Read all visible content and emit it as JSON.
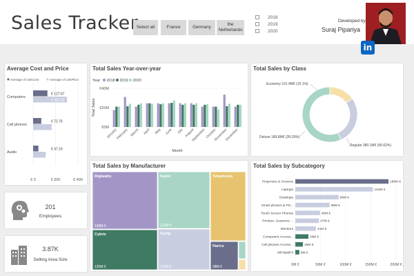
{
  "header": {
    "title": "Sales Tracker",
    "countries": [
      "Select all",
      "France",
      "Germany",
      "the Netherlands"
    ],
    "years": [
      "2018",
      "2019",
      "2020"
    ],
    "developed_by": "Developed by",
    "developer": "Suraj Pipariya",
    "linkedin": "in"
  },
  "colors": {
    "y2018": "#a495c7",
    "y2019": "#3f7a62",
    "y2020": "#a8d5c6",
    "cost": "#6b6e8a",
    "price": "#c9cde0"
  },
  "kpis": {
    "employees_value": "201",
    "employees_label": "Employees",
    "area_value": "3.87K",
    "area_label": "Selling Area Size"
  },
  "chart_data": [
    {
      "type": "bar",
      "title": "Average Cost and Price",
      "orientation": "horizontal",
      "categories": [
        "Computers",
        "Cell phones",
        "Audio"
      ],
      "series": [
        {
          "name": "Average of UnitCost",
          "values": [
            127.67,
            72.76,
            47.19
          ],
          "labels": [
            "€ 127.67",
            "€ 72.76",
            "€ 47.19"
          ]
        },
        {
          "name": "Average of UnitPrice",
          "values": [
            302.13,
            167.08,
            112.03
          ],
          "labels": [
            "€ 302.13",
            "€ 167.08",
            "€ 112.03"
          ]
        }
      ],
      "xticks": [
        "€ 0",
        "€ 200",
        "€ 400"
      ],
      "xlim": [
        0,
        400
      ]
    },
    {
      "type": "bar",
      "title": "Total Sales Year-over-year",
      "legend_title": "Year",
      "categories": [
        "January",
        "February",
        "March",
        "April",
        "May",
        "June",
        "July",
        "August",
        "September",
        "October",
        "November",
        "December"
      ],
      "series": [
        {
          "name": "2018",
          "values": [
            17.5,
            31,
            21,
            24.5,
            24.5,
            24.5,
            24.5,
            24.5,
            21,
            21,
            33.5,
            21
          ]
        },
        {
          "name": "2019",
          "values": [
            21,
            21.5,
            23,
            24.5,
            23.5,
            25,
            23,
            23,
            23,
            21,
            21.5,
            23
          ]
        },
        {
          "name": "2020",
          "values": [
            21,
            24,
            24.5,
            24,
            24.5,
            27.5,
            24.5,
            24.5,
            23.5,
            18,
            24,
            23
          ]
        }
      ],
      "ylabel": "Total Sales",
      "xlabel": "Month",
      "yticks": [
        "€0M",
        "€20M",
        "€40M"
      ],
      "ylim": [
        0,
        40
      ]
    },
    {
      "type": "pie",
      "title": "Total Sales by Class",
      "slices": [
        {
          "label": "Economy",
          "value": 101.4,
          "text": "Economy 101.4M€ (15.1%)"
        },
        {
          "label": "Deluxe",
          "value": 189.8,
          "text": "Deluxe 189.8M€ (28.29%)"
        },
        {
          "label": "Regular",
          "value": 380.1,
          "text": "Regular 380.1M€ (56.62%)"
        }
      ],
      "colors": [
        "#f6e0a8",
        "#c9cde0",
        "#a8d5c6"
      ]
    },
    {
      "type": "treemap",
      "title": "Total Sales by Manufacturer",
      "items": [
        {
          "name": "Digiwatts",
          "value": 158,
          "label": "158M €",
          "color": "#a495c7"
        },
        {
          "name": "Cybric",
          "value": 125,
          "label": "125M €",
          "color": "#3f7a62"
        },
        {
          "name": "Kader",
          "value": 122,
          "label": "122M €",
          "color": "#a8d5c6"
        },
        {
          "name": "Teclip",
          "value": 111,
          "label": "111M €",
          "color": "#c9cde0"
        },
        {
          "name": "Telephoniq",
          "value": 80,
          "label": "",
          "color": "#e7c36f"
        },
        {
          "name": "Harics",
          "value": 38,
          "label": "38M €",
          "color": "#6b6e8a"
        },
        {
          "name": "",
          "value": 8,
          "label": "",
          "color": "#a8d5c6"
        },
        {
          "name": "",
          "value": 6,
          "label": "",
          "color": "#f6e0a8"
        }
      ]
    },
    {
      "type": "bar",
      "title": "Total Sales by Subcategory",
      "orientation": "horizontal",
      "categories": [
        "Projectors & Screens",
        "Laptops",
        "Desktops",
        "Smart phones & PD...",
        "Touch Screen Phones",
        "Printers, Scanners ...",
        "Monitors",
        "Computers Access...",
        "Cell phones Access...",
        "MP4&MP3"
      ],
      "values": [
        185,
        154,
        86,
        68,
        49,
        47,
        41,
        26,
        15,
        8
      ],
      "labels": [
        "185M €",
        "154M €",
        "86M €",
        "68M €",
        "49M €",
        "47M €",
        "41M €",
        "26M €",
        "15M €",
        "8M €"
      ],
      "colors": [
        "#6b6e8a",
        "#c9cde0",
        "#c9cde0",
        "#c9cde0",
        "#c9cde0",
        "#c9cde0",
        "#c9cde0",
        "#3f7a62",
        "#3f7a62",
        "#3f7a62"
      ],
      "xticks": [
        "0M €",
        "50M €",
        "100M €",
        "150M €",
        "200M €"
      ],
      "xlim": [
        0,
        200
      ]
    }
  ]
}
